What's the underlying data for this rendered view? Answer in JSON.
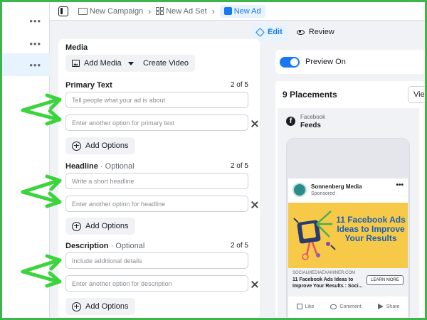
{
  "breadcrumb": {
    "items": [
      {
        "label": "New Campaign"
      },
      {
        "label": "New Ad Set"
      },
      {
        "label": "New Ad"
      }
    ]
  },
  "modes": {
    "edit": "Edit",
    "review": "Review"
  },
  "left_rail": {
    "menu_glyph": "•••"
  },
  "media": {
    "label": "Media",
    "add_media": "Add Media",
    "create_video": "Create Video"
  },
  "primary_text": {
    "label": "Primary Text",
    "count": "2 of 5",
    "placeholder_1": "Tell people what your ad is about",
    "placeholder_2": "Enter another option for primary text",
    "add_options": "Add Options"
  },
  "headline": {
    "label": "Headline",
    "optional": " · Optional",
    "count": "2 of 5",
    "placeholder_1": "Write a short headline",
    "placeholder_2": "Enter another option for headline",
    "add_options": "Add Options"
  },
  "description": {
    "label": "Description",
    "optional": " · Optional",
    "count": "2 of 5",
    "placeholder_1": "Include additional details",
    "placeholder_2": "Enter another option for description",
    "add_options": "Add Options"
  },
  "preview": {
    "toggle_label": "Preview On",
    "placements_title": "9 Placements",
    "view_button": "Vie",
    "platform": "Facebook",
    "placement": "Feeds",
    "post": {
      "page_name": "Sonnenberg Media",
      "sponsored": "Sponsored ·",
      "image_headline": "11 Facebook Ads Ideas to Improve Your Results",
      "domain": "SOCIALMEDIAEXAMINER.COM",
      "link_title": "11 Facebook Ads Ideas to Improve Your Results : Soci...",
      "cta": "LEARN MORE",
      "actions": {
        "like": "Like",
        "comment": "Comment",
        "share": "Share"
      }
    }
  },
  "colors": {
    "accent": "#1877f2",
    "annotation_arrow": "#3cd43c",
    "frame_border": "#3cb64a",
    "ad_image_bg": "#f7c948"
  }
}
